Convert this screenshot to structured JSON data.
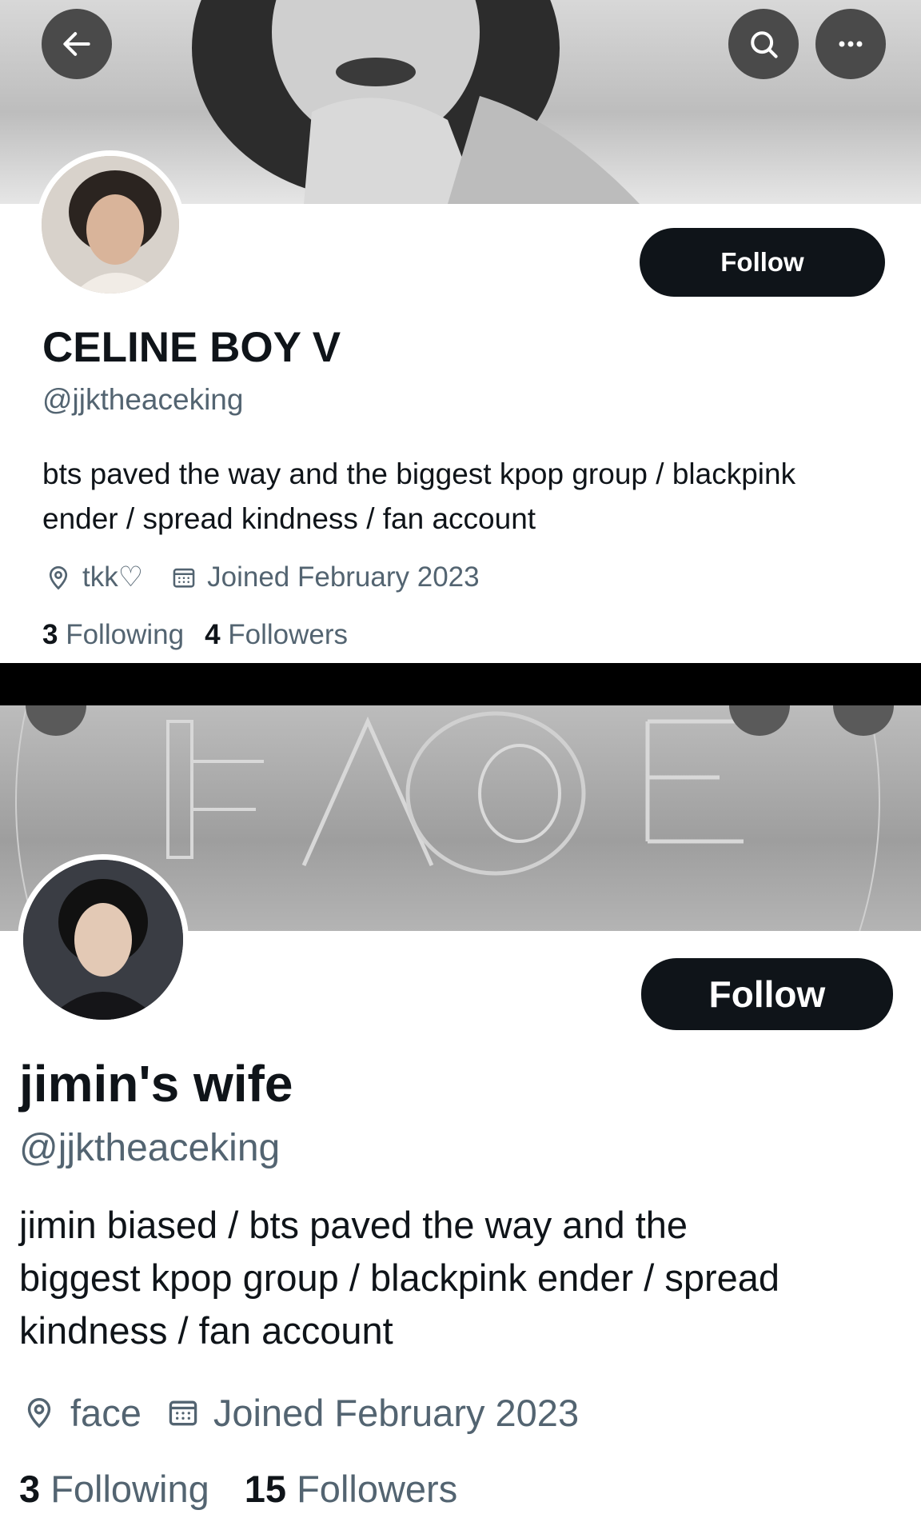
{
  "profiles": [
    {
      "name": "CELINE BOY V",
      "handle": "@jjktheaceking",
      "follow_label": "Follow",
      "bio_line1": "bts paved the way and the biggest kpop group / blackpink",
      "bio_line2": "ender / spread kindness / fan account",
      "location": "tkk♡",
      "joined": "Joined February 2023",
      "following_count": "3",
      "following_label": "Following",
      "followers_count": "4",
      "followers_label": "Followers"
    },
    {
      "name": "jimin's wife",
      "handle": "@jjktheaceking",
      "follow_label": "Follow",
      "bio_line1": "jimin biased / bts paved the way and the",
      "bio_line2": "biggest kpop group / blackpink ender / spread",
      "bio_line3": "kindness / fan account",
      "location": "face",
      "joined": "Joined February 2023",
      "following_count": "3",
      "following_label": "Following",
      "followers_count": "15",
      "followers_label": "Followers"
    }
  ],
  "icons": [
    "back-arrow-icon",
    "search-icon",
    "more-icon",
    "location-pin-icon",
    "calendar-icon"
  ],
  "colors": {
    "text": "#0f1419",
    "secondary": "#536471",
    "button_bg": "#0f1419",
    "button_text": "#ffffff"
  }
}
